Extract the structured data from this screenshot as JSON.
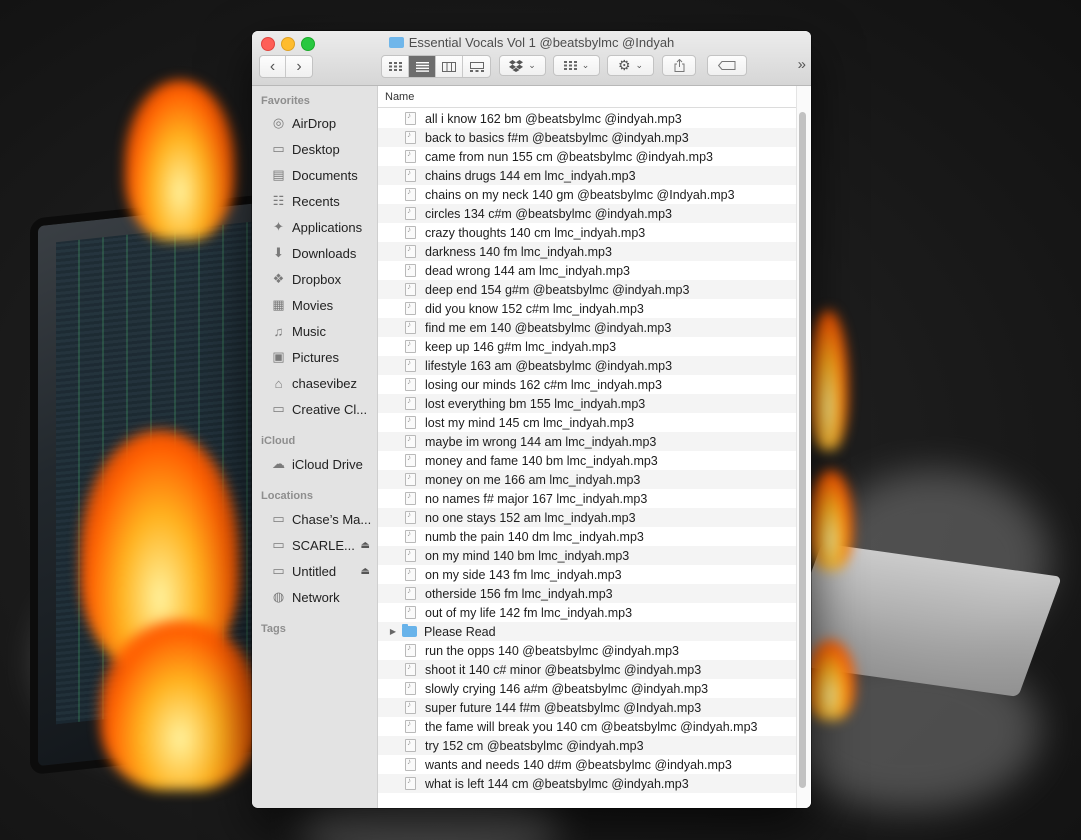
{
  "window": {
    "title": "Essential Vocals Vol 1 @beatsbylmc @Indyah"
  },
  "toolbar": {
    "back": "‹",
    "forward": "›",
    "more": "»"
  },
  "sidebar": {
    "favorites_heading": "Favorites",
    "favorites": [
      {
        "label": "AirDrop",
        "icon": "airdrop-icon"
      },
      {
        "label": "Desktop",
        "icon": "desktop-icon"
      },
      {
        "label": "Documents",
        "icon": "documents-icon"
      },
      {
        "label": "Recents",
        "icon": "recents-icon"
      },
      {
        "label": "Applications",
        "icon": "applications-icon"
      },
      {
        "label": "Downloads",
        "icon": "downloads-icon"
      },
      {
        "label": "Dropbox",
        "icon": "dropbox-icon"
      },
      {
        "label": "Movies",
        "icon": "movies-icon"
      },
      {
        "label": "Music",
        "icon": "music-icon"
      },
      {
        "label": "Pictures",
        "icon": "pictures-icon"
      },
      {
        "label": "chasevibez",
        "icon": "home-icon"
      },
      {
        "label": "Creative Cl...",
        "icon": "folder-icon"
      }
    ],
    "icloud_heading": "iCloud",
    "icloud": [
      {
        "label": "iCloud Drive",
        "icon": "cloud-icon"
      }
    ],
    "locations_heading": "Locations",
    "locations": [
      {
        "label": "Chase’s Ma...",
        "icon": "computer-icon",
        "eject": ""
      },
      {
        "label": "SCARLE...",
        "icon": "drive-icon",
        "eject": "⏏"
      },
      {
        "label": "Untitled",
        "icon": "drive-icon",
        "eject": "⏏"
      },
      {
        "label": "Network",
        "icon": "network-icon",
        "eject": ""
      }
    ],
    "tags_heading": "Tags"
  },
  "list": {
    "column_name": "Name",
    "files": [
      {
        "name": "all i know 162 bm @beatsbylmc @indyah.mp3",
        "kind": "file"
      },
      {
        "name": "back to basics f#m @beatsbylmc @indyah.mp3",
        "kind": "file"
      },
      {
        "name": "came from nun 155 cm @beatsbylmc @indyah.mp3",
        "kind": "file"
      },
      {
        "name": "chains drugs 144 em lmc_indyah.mp3",
        "kind": "file"
      },
      {
        "name": "chains on my neck 140 gm @beatsbylmc @Indyah.mp3",
        "kind": "file"
      },
      {
        "name": "circles 134 c#m @beatsbylmc @indyah.mp3",
        "kind": "file"
      },
      {
        "name": "crazy thoughts 140 cm lmc_indyah.mp3",
        "kind": "file"
      },
      {
        "name": "darkness 140 fm lmc_indyah.mp3",
        "kind": "file"
      },
      {
        "name": "dead wrong 144 am lmc_indyah.mp3",
        "kind": "file"
      },
      {
        "name": "deep end 154 g#m @beatsbylmc @indyah.mp3",
        "kind": "file"
      },
      {
        "name": "did you know 152 c#m lmc_indyah.mp3",
        "kind": "file"
      },
      {
        "name": "find me em 140 @beatsbylmc @indyah.mp3",
        "kind": "file"
      },
      {
        "name": "keep up 146 g#m lmc_indyah.mp3",
        "kind": "file"
      },
      {
        "name": "lifestyle 163 am @beatsbylmc @indyah.mp3",
        "kind": "file"
      },
      {
        "name": "losing our minds 162 c#m lmc_indyah.mp3",
        "kind": "file"
      },
      {
        "name": "lost everything bm 155 lmc_indyah.mp3",
        "kind": "file"
      },
      {
        "name": "lost my mind 145 cm lmc_indyah.mp3",
        "kind": "file"
      },
      {
        "name": "maybe im wrong 144 am lmc_indyah.mp3",
        "kind": "file"
      },
      {
        "name": "money and fame 140 bm lmc_indyah.mp3",
        "kind": "file"
      },
      {
        "name": "money on me 166 am lmc_indyah.mp3",
        "kind": "file"
      },
      {
        "name": "no names f# major 167 lmc_indyah.mp3",
        "kind": "file"
      },
      {
        "name": "no one stays 152 am lmc_indyah.mp3",
        "kind": "file"
      },
      {
        "name": "numb the pain 140 dm lmc_indyah.mp3",
        "kind": "file"
      },
      {
        "name": "on my mind 140 bm lmc_indyah.mp3",
        "kind": "file"
      },
      {
        "name": "on my side 143 fm lmc_indyah.mp3",
        "kind": "file"
      },
      {
        "name": "otherside 156 fm lmc_indyah.mp3",
        "kind": "file"
      },
      {
        "name": "out of my life 142 fm lmc_indyah.mp3",
        "kind": "file"
      },
      {
        "name": "Please Read",
        "kind": "folder"
      },
      {
        "name": "run the opps 140 @beatsbylmc @indyah.mp3",
        "kind": "file"
      },
      {
        "name": "shoot it 140 c# minor @beatsbylmc @indyah.mp3",
        "kind": "file"
      },
      {
        "name": "slowly crying 146 a#m @beatsbylmc @indyah.mp3",
        "kind": "file"
      },
      {
        "name": "super future 144 f#m @beatsbylmc @Indyah.mp3",
        "kind": "file"
      },
      {
        "name": "the fame will break you 140 cm @beatsbylmc @indyah.mp3",
        "kind": "file"
      },
      {
        "name": "try 152 cm @beatsbylmc @indyah.mp3",
        "kind": "file"
      },
      {
        "name": "wants and needs 140 d#m @beatsbylmc @indyah.mp3",
        "kind": "file"
      },
      {
        "name": "what is left 144 cm @beatsbylmc @indyah.mp3",
        "kind": "file"
      }
    ]
  },
  "colors": {
    "close": "#fe5f57",
    "minimize": "#febc2e",
    "maximize": "#28c840",
    "folder": "#68b3ea",
    "sidebar_bg": "#e3e3e3"
  }
}
